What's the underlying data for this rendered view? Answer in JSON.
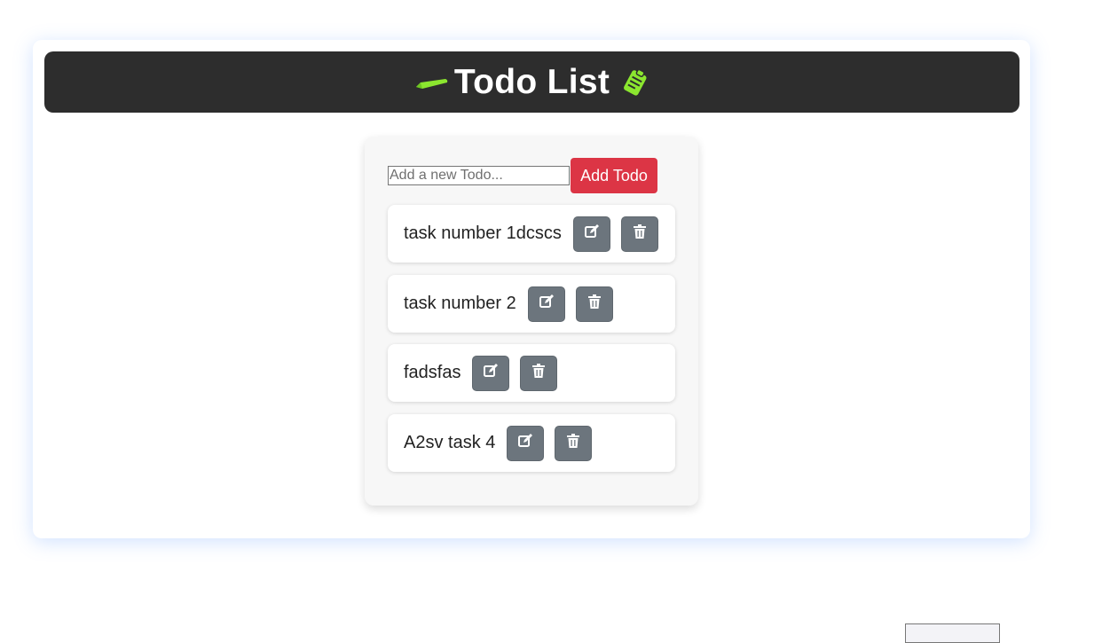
{
  "header": {
    "title": "Todo List",
    "left_icon": "pencil-icon",
    "right_icon": "clipboard-icon",
    "accent_color": "#8be62f"
  },
  "add_form": {
    "placeholder": "Add a new Todo...",
    "value": "",
    "button_label": "Add Todo",
    "button_color": "#dc3545"
  },
  "todos": [
    {
      "text": "task number 1dcscs",
      "edit_icon": "edit-icon",
      "delete_icon": "trash-icon"
    },
    {
      "text": "task number 2",
      "edit_icon": "edit-icon",
      "delete_icon": "trash-icon"
    },
    {
      "text": "fadsfas",
      "edit_icon": "edit-icon",
      "delete_icon": "trash-icon"
    },
    {
      "text": "A2sv task 4",
      "edit_icon": "edit-icon",
      "delete_icon": "trash-icon"
    }
  ],
  "colors": {
    "header_bg": "#2d2d2d",
    "icon_button_bg": "#6c757d",
    "card_bg": "#f7f7f7"
  }
}
